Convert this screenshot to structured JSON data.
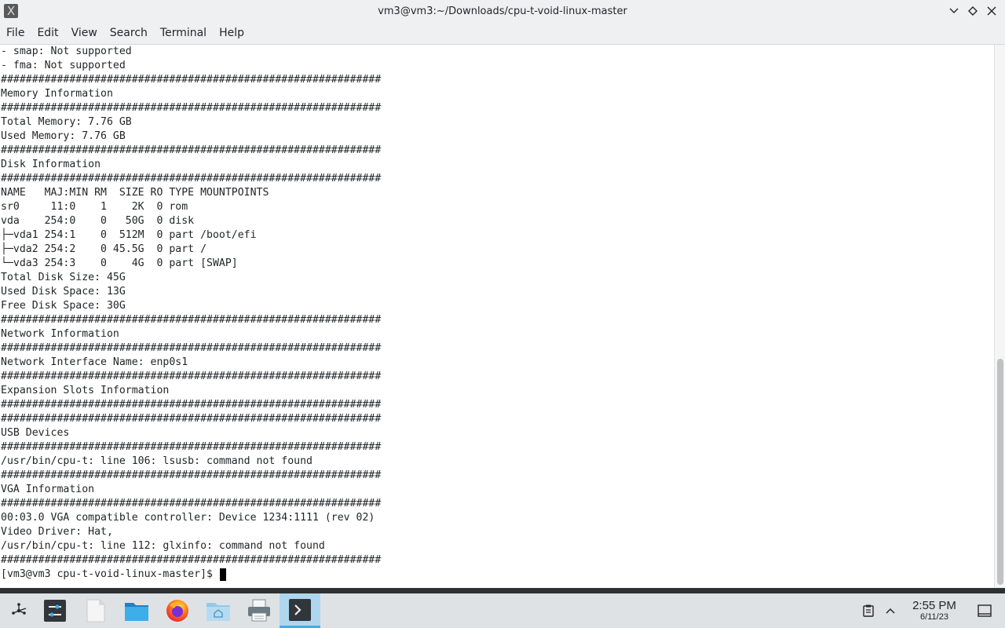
{
  "window": {
    "title": "vm3@vm3:~/Downloads/cpu-t-void-linux-master",
    "app_icon_glyph": "X"
  },
  "menubar": {
    "items": [
      "File",
      "Edit",
      "View",
      "Search",
      "Terminal",
      "Help"
    ]
  },
  "terminal": {
    "lines": [
      "- smap: Not supported",
      "- fma: Not supported",
      "#############################################################",
      "Memory Information",
      "#############################################################",
      "Total Memory: 7.76 GB",
      "Used Memory: 7.76 GB",
      "#############################################################",
      "Disk Information",
      "#############################################################",
      "NAME   MAJ:MIN RM  SIZE RO TYPE MOUNTPOINTS",
      "sr0     11:0    1    2K  0 rom",
      "vda    254:0    0   50G  0 disk",
      "├─vda1 254:1    0  512M  0 part /boot/efi",
      "├─vda2 254:2    0 45.5G  0 part /",
      "└─vda3 254:3    0    4G  0 part [SWAP]",
      "Total Disk Size: 45G",
      "Used Disk Space: 13G",
      "Free Disk Space: 30G",
      "#############################################################",
      "Network Information",
      "#############################################################",
      "Network Interface Name: enp0s1",
      "#############################################################",
      "Expansion Slots Information",
      "#############################################################",
      "#############################################################",
      "USB Devices",
      "#############################################################",
      "/usr/bin/cpu-t: line 106: lsusb: command not found",
      "#############################################################",
      "VGA Information",
      "#############################################################",
      "00:03.0 VGA compatible controller: Device 1234:1111 (rev 02)",
      "Video Driver: Hat,",
      "/usr/bin/cpu-t: line 112: glxinfo: command not found",
      "#############################################################"
    ],
    "prompt": "[vm3@vm3 cpu-t-void-linux-master]$ "
  },
  "taskbar": {
    "items": [
      {
        "name": "application-launcher",
        "icon": "launcher-icon"
      },
      {
        "name": "system-settings",
        "icon": "settings-icon"
      },
      {
        "name": "text-editor",
        "icon": "document-icon"
      },
      {
        "name": "file-manager",
        "icon": "folder-icon"
      },
      {
        "name": "firefox",
        "icon": "firefox-icon"
      },
      {
        "name": "home-folder",
        "icon": "home-folder-icon"
      },
      {
        "name": "printer",
        "icon": "printer-icon"
      },
      {
        "name": "terminal",
        "icon": "terminal-icon",
        "active": true
      }
    ],
    "tray": {
      "clipboard_icon": "clipboard-icon",
      "expand_icon": "chevron-up-icon",
      "time": "2:55 PM",
      "date": "6/11/23",
      "show_desktop_icon": "show-desktop-icon"
    }
  },
  "colors": {
    "accent": "#3daee9",
    "panel_bg": "#dfe2e5",
    "titlebar_bg": "#eff0f1",
    "text": "#232629"
  }
}
